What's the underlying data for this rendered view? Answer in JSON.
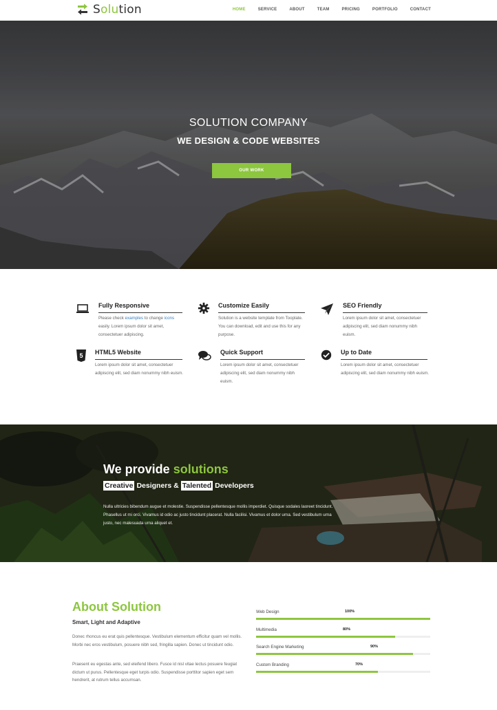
{
  "brand": {
    "name_pre": "S",
    "name_hl": "olu",
    "name_post": "tion",
    "accent": "#8dc63f"
  },
  "nav": {
    "items": [
      "HOME",
      "SERVICE",
      "ABOUT",
      "TEAM",
      "PRICING",
      "PORTFOLIO",
      "CONTACT"
    ],
    "active": "HOME"
  },
  "hero": {
    "subtitle": "SOLUTION COMPANY",
    "title": "WE DESIGN & CODE WEBSITES",
    "button": "OUR WORK"
  },
  "features": [
    {
      "icon": "laptop-icon",
      "title": "Fully Responsive",
      "text_parts": [
        "Please check ",
        "examples",
        " to change ",
        "icons",
        " easily. Lorem ipsum dolor sit amet, consectetuer adipiscing."
      ]
    },
    {
      "icon": "gear-icon",
      "title": "Customize Easily",
      "text": "Solution is a website template from Tooplate. You can download, edit and use this for any purpose."
    },
    {
      "icon": "paper-plane-icon",
      "title": "SEO Friendly",
      "text": "Lorem ipsum dolor sit amet, consectetuer adipiscing elit, sed diam nonummy nibh euism."
    },
    {
      "icon": "html5-icon",
      "title": "HTML5 Website",
      "text": "Lorem ipsum dolor sit amet, consectetuer adipiscing elit, sed diam nonummy nibh euism."
    },
    {
      "icon": "chat-bubbles-icon",
      "title": "Quick Support",
      "text": "Lorem ipsum dolor sit amet, consectetuer adipiscing elit, sed diam nonummy nibh euism."
    },
    {
      "icon": "check-circle-icon",
      "title": "Up to Date",
      "text": "Lorem ipsum dolor sit amet, consectetuer adipiscing elit, sed diam nonummy nibh euism."
    }
  ],
  "solutions": {
    "title_pre": "We provide ",
    "title_hl": "solutions",
    "sub_word1": "Creative",
    "sub_mid": "Designers &",
    "sub_word2": "Talented",
    "sub_end": "Developers",
    "text": "Nulla ultricies bibendum augue et molestie. Suspendisse pellentesque mollis imperdiet. Quisque sodales laoreet tincidunt. Phasellus ut mi orci. Vivamus id odio ac justo tincidunt placerat. Nulla facilisi. Vivamus et dolor urna. Sed vestibulum urna justo, nec malesuada urna aliquet et."
  },
  "about": {
    "title": "About Solution",
    "subtitle": "Smart, Light and Adaptive",
    "para1": "Donec rhoncus eu erat quis pellentesque. Vestibulum elementum efficitur quam vel mollis. Morbi nec eros vestibulum, posuere nibh sed, fringilla sapien. Donec ut tincidunt odio.",
    "para2": "Praesent eu egestas ante, sed eleifend libero. Fusce id nisl vitae lectus posuere feugiat dictum ut purus. Pellentesque eget turpis odio. Suspendisse porttitor sapien eget sem hendrerit, at rutrum tellus accumsan.",
    "skills": [
      {
        "name": "Web Design",
        "percent": 100,
        "label": "100%"
      },
      {
        "name": "Multimedia",
        "percent": 80,
        "label": "80%"
      },
      {
        "name": "Search Engine Marketing",
        "percent": 90,
        "label": "90%"
      },
      {
        "name": "Custom Branding",
        "percent": 70,
        "label": "70%"
      }
    ]
  }
}
